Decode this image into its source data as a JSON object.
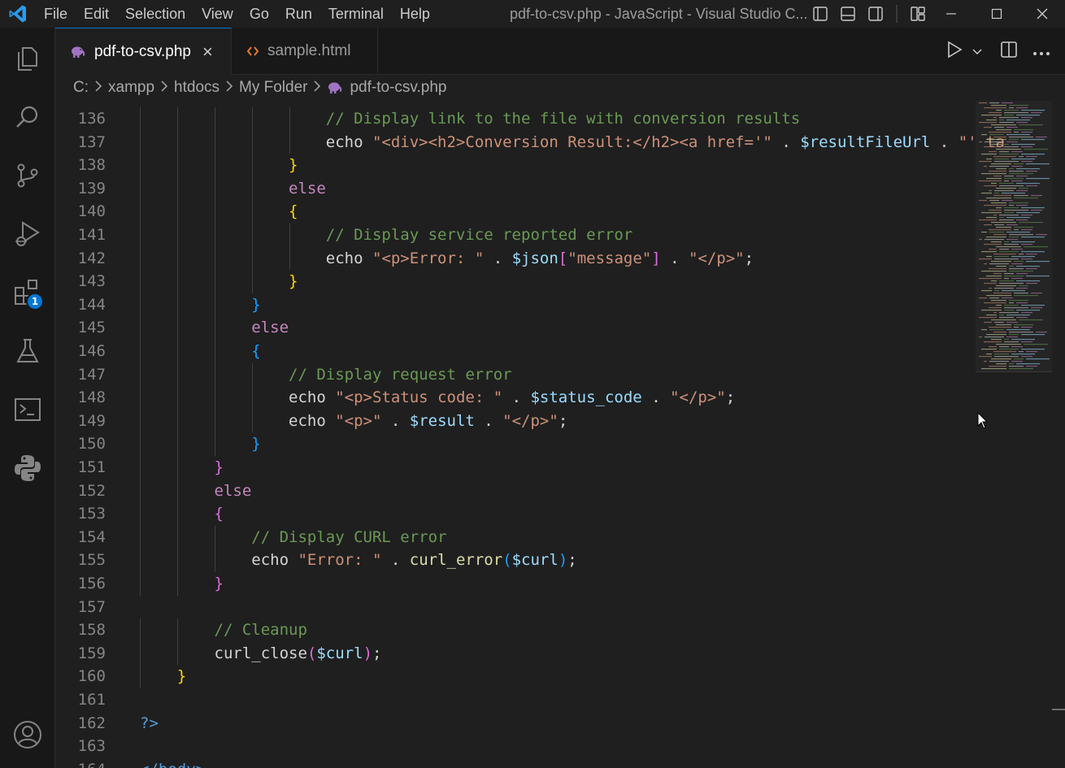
{
  "menu": [
    "File",
    "Edit",
    "Selection",
    "View",
    "Go",
    "Run",
    "Terminal",
    "Help"
  ],
  "window_title": "pdf-to-csv.php - JavaScript - Visual Studio C...",
  "extensions_badge": "1",
  "tabs": [
    {
      "label": "pdf-to-csv.php",
      "close": "×"
    },
    {
      "label": "sample.html"
    }
  ],
  "breadcrumb": [
    "C:",
    "xampp",
    "htdocs",
    "My Folder",
    "pdf-to-csv.php"
  ],
  "editor": {
    "language": "php",
    "first_line": 136,
    "lines": [
      [
        [
          "c",
          "// Display link to the file with conversion results"
        ]
      ],
      [
        [
          "t",
          "echo "
        ],
        [
          "s",
          "\"<div><h2>Conversion Result:</h2><a href='\""
        ],
        [
          "t",
          " . "
        ],
        [
          "v",
          "$resultFileUrl"
        ],
        [
          "t",
          " . "
        ],
        [
          "s",
          "\"' ta"
        ]
      ],
      [
        [
          "b1",
          "}"
        ]
      ],
      [
        [
          "k",
          "else"
        ]
      ],
      [
        [
          "b1",
          "{"
        ]
      ],
      [
        [
          "c",
          "// Display service reported error"
        ]
      ],
      [
        [
          "t",
          "echo "
        ],
        [
          "s",
          "\"<p>Error: \""
        ],
        [
          "t",
          " . "
        ],
        [
          "v",
          "$json"
        ],
        [
          "b2",
          "["
        ],
        [
          "s",
          "\"message\""
        ],
        [
          "b2",
          "]"
        ],
        [
          "t",
          " . "
        ],
        [
          "s",
          "\"</p>\""
        ],
        [
          "t",
          ";"
        ]
      ],
      [
        [
          "b1",
          "}"
        ]
      ],
      [
        [
          "b3",
          "}"
        ]
      ],
      [
        [
          "k",
          "else"
        ]
      ],
      [
        [
          "b3",
          "{"
        ]
      ],
      [
        [
          "c",
          "// Display request error"
        ]
      ],
      [
        [
          "t",
          "echo "
        ],
        [
          "s",
          "\"<p>Status code: \""
        ],
        [
          "t",
          " . "
        ],
        [
          "v",
          "$status_code"
        ],
        [
          "t",
          " . "
        ],
        [
          "s",
          "\"</p>\""
        ],
        [
          "t",
          ";"
        ]
      ],
      [
        [
          "t",
          "echo "
        ],
        [
          "s",
          "\"<p>\""
        ],
        [
          "t",
          " . "
        ],
        [
          "v",
          "$result"
        ],
        [
          "t",
          " . "
        ],
        [
          "s",
          "\"</p>\""
        ],
        [
          "t",
          ";"
        ]
      ],
      [
        [
          "b3",
          "}"
        ]
      ],
      [
        [
          "b2",
          "}"
        ]
      ],
      [
        [
          "k",
          "else"
        ]
      ],
      [
        [
          "b2",
          "{"
        ]
      ],
      [
        [
          "c",
          "// Display CURL error"
        ]
      ],
      [
        [
          "t",
          "echo "
        ],
        [
          "s",
          "\"Error: \""
        ],
        [
          "t",
          " . "
        ],
        [
          "f",
          "curl_error"
        ],
        [
          "b3",
          "("
        ],
        [
          "v",
          "$curl"
        ],
        [
          "b3",
          ")"
        ],
        [
          "t",
          ";"
        ]
      ],
      [
        [
          "b2",
          "}"
        ]
      ],
      [],
      [
        [
          "c",
          "// Cleanup"
        ]
      ],
      [
        [
          "t",
          "curl_close"
        ],
        [
          "b2",
          "("
        ],
        [
          "v",
          "$curl"
        ],
        [
          "b2",
          ")"
        ],
        [
          "t",
          ";"
        ]
      ],
      [
        [
          "b1",
          "}"
        ]
      ],
      [],
      [
        [
          "g",
          "?>"
        ]
      ],
      [],
      [
        [
          "g",
          "</body>"
        ]
      ]
    ]
  },
  "colors": {
    "accent": "#0078d4",
    "comment": "#6a9955",
    "string": "#ce9178",
    "variable": "#9cdcfe",
    "keyword": "#c586c0",
    "bracket_gold": "#ffd700",
    "bracket_orchid": "#da70d6",
    "bracket_blue": "#179fff"
  }
}
